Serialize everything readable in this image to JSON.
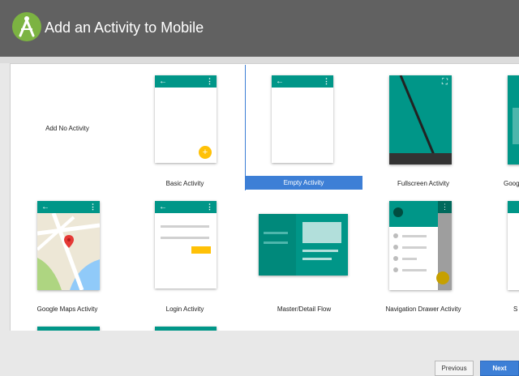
{
  "header": {
    "title": "Add an Activity to Mobile",
    "logo_icon": "android-studio-icon"
  },
  "templates": [
    {
      "label": "Add No Activity"
    },
    {
      "label": "Basic Activity"
    },
    {
      "label": "Empty Activity",
      "selected": true
    },
    {
      "label": "Fullscreen Activity"
    },
    {
      "label": "Google"
    },
    {
      "label": "Google Maps Activity"
    },
    {
      "label": "Login Activity"
    },
    {
      "label": "Master/Detail Flow"
    },
    {
      "label": "Navigation Drawer Activity"
    },
    {
      "label": "S"
    }
  ],
  "footer": {
    "previous_label": "Previous",
    "next_label": "Next"
  },
  "colors": {
    "header_bg": "#616161",
    "teal": "#009688",
    "selection": "#3d7fd6",
    "fab": "#ffc107"
  }
}
